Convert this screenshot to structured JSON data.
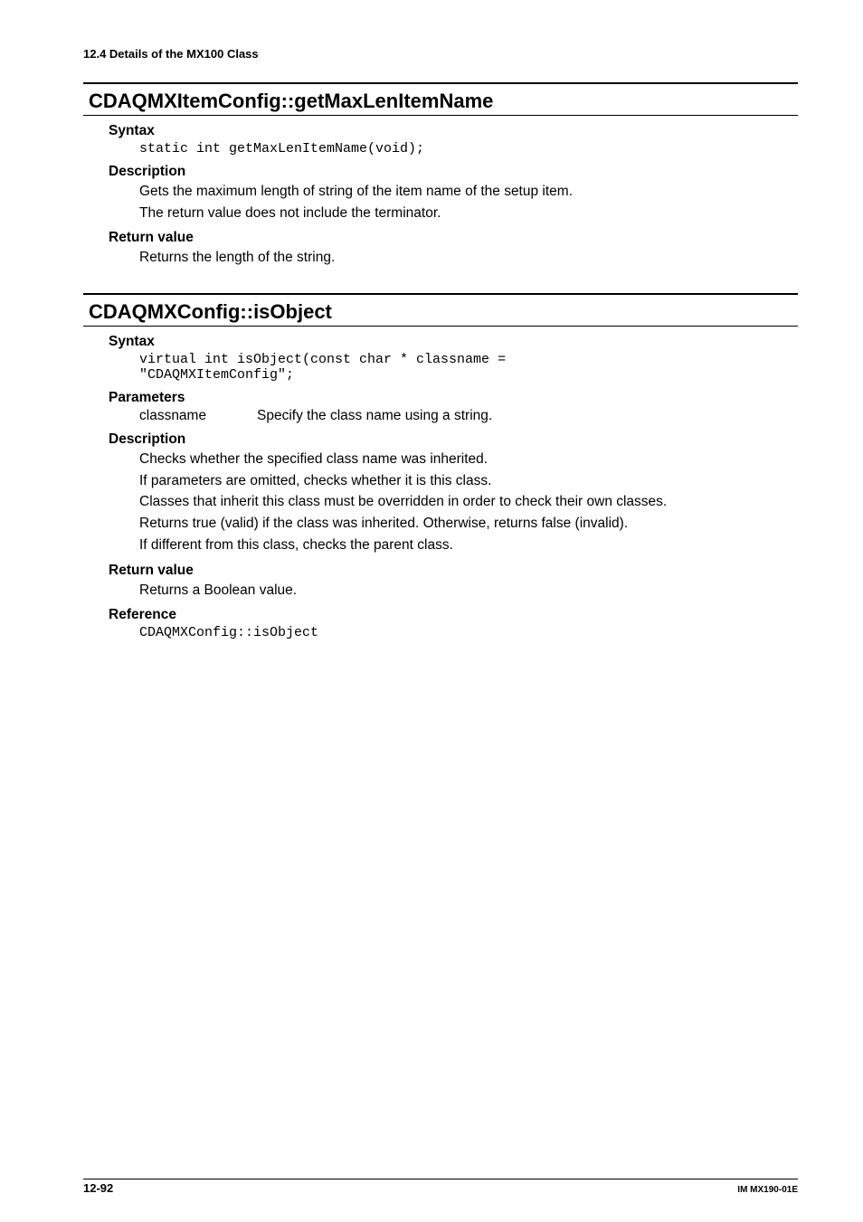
{
  "breadcrumb": "12.4  Details of the MX100 Class",
  "section1": {
    "title": "CDAQMXItemConfig::getMaxLenItemName",
    "syntax": {
      "heading": "Syntax",
      "code": "static int getMaxLenItemName(void);"
    },
    "description": {
      "heading": "Description",
      "lines": [
        "Gets the maximum length of string of the item name of the setup item.",
        "The return value does not include the terminator."
      ]
    },
    "returnValue": {
      "heading": "Return value",
      "lines": [
        "Returns the length of the string."
      ]
    }
  },
  "section2": {
    "title": "CDAQMXConfig::isObject",
    "syntax": {
      "heading": "Syntax",
      "code": "virtual int isObject(const char * classname =\n\"CDAQMXItemConfig\";"
    },
    "parameters": {
      "heading": "Parameters",
      "items": [
        {
          "name": "classname",
          "desc": "Specify the class name using a string."
        }
      ]
    },
    "description": {
      "heading": "Description",
      "lines": [
        "Checks whether the specified class name was inherited.",
        "If parameters are omitted, checks whether it is this class.",
        "Classes that inherit this class must be overridden in order to check their own classes.",
        "Returns true (valid) if the class was inherited. Otherwise, returns false (invalid).",
        "If different from this class, checks the parent class."
      ]
    },
    "returnValue": {
      "heading": "Return value",
      "lines": [
        "Returns a Boolean value."
      ]
    },
    "reference": {
      "heading": "Reference",
      "code": "CDAQMXConfig::isObject"
    }
  },
  "footer": {
    "pageNum": "12-92",
    "manualId": "IM MX190-01E"
  }
}
